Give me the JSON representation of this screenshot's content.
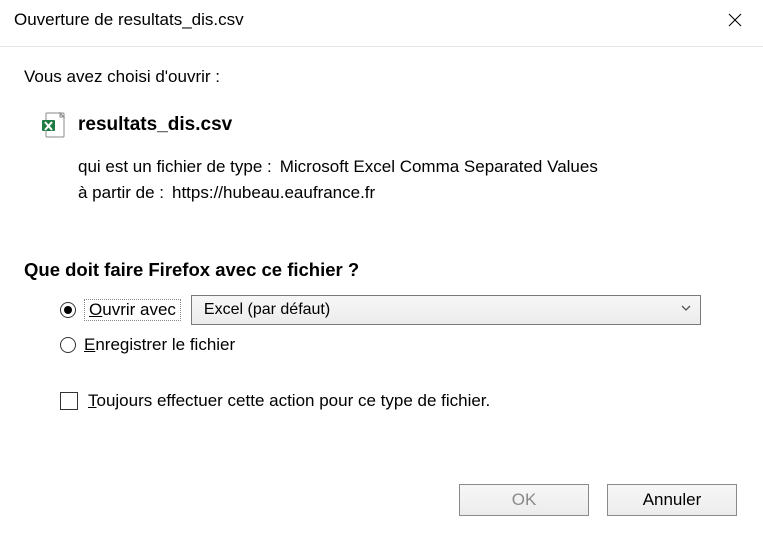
{
  "titlebar": {
    "title": "Ouverture de resultats_dis.csv"
  },
  "intro": "Vous avez choisi d'ouvrir :",
  "file": {
    "name": "resultats_dis.csv"
  },
  "meta": {
    "type_label": "qui est un fichier de type :",
    "type_value": "Microsoft Excel Comma Separated Values",
    "from_label": "à partir de :",
    "from_value": "https://hubeau.eaufrance.fr"
  },
  "question": "Que doit faire Firefox avec ce fichier ?",
  "options": {
    "open_label_rest": "uvrir avec",
    "open_dropdown": "Excel (par défaut)",
    "save_label_rest": "nregistrer le fichier",
    "always_label_rest": "oujours effectuer cette action pour ce type de fichier."
  },
  "buttons": {
    "ok": "OK",
    "cancel": "Annuler"
  }
}
